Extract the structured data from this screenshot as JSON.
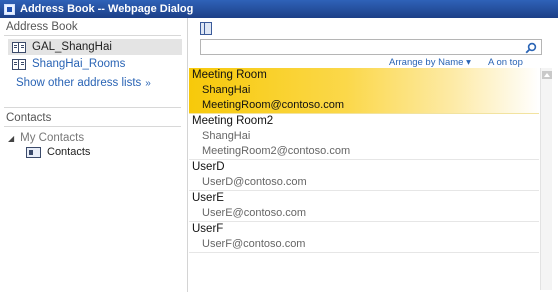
{
  "window": {
    "title": "Address Book -- Webpage Dialog"
  },
  "sidebar": {
    "header": "Address Book",
    "items": [
      {
        "label": "GAL_ShangHai",
        "icon": "address-book-icon",
        "selected": true
      },
      {
        "label": "ShangHai_Rooms",
        "icon": "address-book-icon",
        "selected": false
      }
    ],
    "show_other_label": "Show other address lists",
    "show_other_chevron": "»",
    "contacts_header": "Contacts",
    "tree": {
      "my_contacts_label": "My Contacts",
      "contacts_label": "Contacts"
    }
  },
  "main": {
    "search": {
      "value": "",
      "placeholder": ""
    },
    "sort": {
      "arrange_label": "Arrange by Name",
      "arrange_chevron": "▾",
      "order_label": "A on top"
    },
    "entries": [
      {
        "name": "Meeting Room",
        "lines": [
          "ShangHai",
          "MeetingRoom@contoso.com"
        ],
        "selected": true
      },
      {
        "name": "Meeting Room2",
        "lines": [
          "ShangHai",
          "MeetingRoom2@contoso.com"
        ],
        "selected": false
      },
      {
        "name": "UserD",
        "lines": [
          "UserD@contoso.com"
        ],
        "selected": false
      },
      {
        "name": "UserE",
        "lines": [
          "UserE@contoso.com"
        ],
        "selected": false
      },
      {
        "name": "UserF",
        "lines": [
          "UserF@contoso.com"
        ],
        "selected": false
      }
    ]
  },
  "colors": {
    "titlebar": "#1c3f87",
    "link": "#2a64b5",
    "selected_highlight": "#f7c90a",
    "sidebar_selected": "#e4e4e4"
  }
}
